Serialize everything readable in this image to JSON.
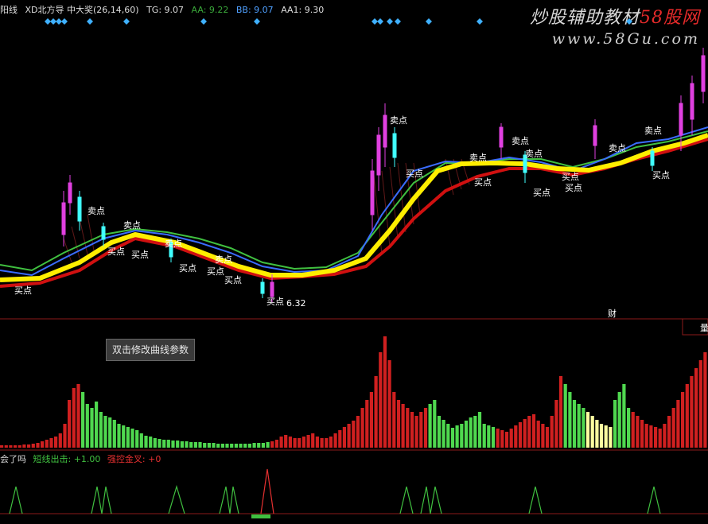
{
  "header": {
    "panel_suffix": "阳线",
    "indicator_name": "XD北方导 中大奖(26,14,60)",
    "tg": "TG: 9.07",
    "aa": "AA: 9.22",
    "bb": "BB: 9.07",
    "aa1": "AA1: 9.30"
  },
  "watermark": {
    "title_main": "炒股辅助教材",
    "title_red": "58股网",
    "url": "www.58Gu.com"
  },
  "tooltip": "双击修改曲线参数",
  "signal_legend": {
    "prefix": "会了吗",
    "short_exit": "短线出击: +1.00",
    "golden_cross": "强控金叉: +0"
  },
  "price_marks": {
    "low_label": "6.32",
    "finance_tag": "财",
    "right_tag": "量"
  },
  "signal_labels": {
    "buy": "买点",
    "sell": "卖点"
  },
  "colors": {
    "up": "#ff3b3b",
    "down": "#3fd0ff",
    "yellow_band": "#ffee00",
    "red_band": "#d01010",
    "green_line": "#40c040",
    "blue_line": "#3a6cff",
    "vol_red": "#d02020",
    "vol_green": "#4fd84f",
    "vol_yellow": "#ffffa0",
    "diamond": "#3fb0ff"
  }
}
